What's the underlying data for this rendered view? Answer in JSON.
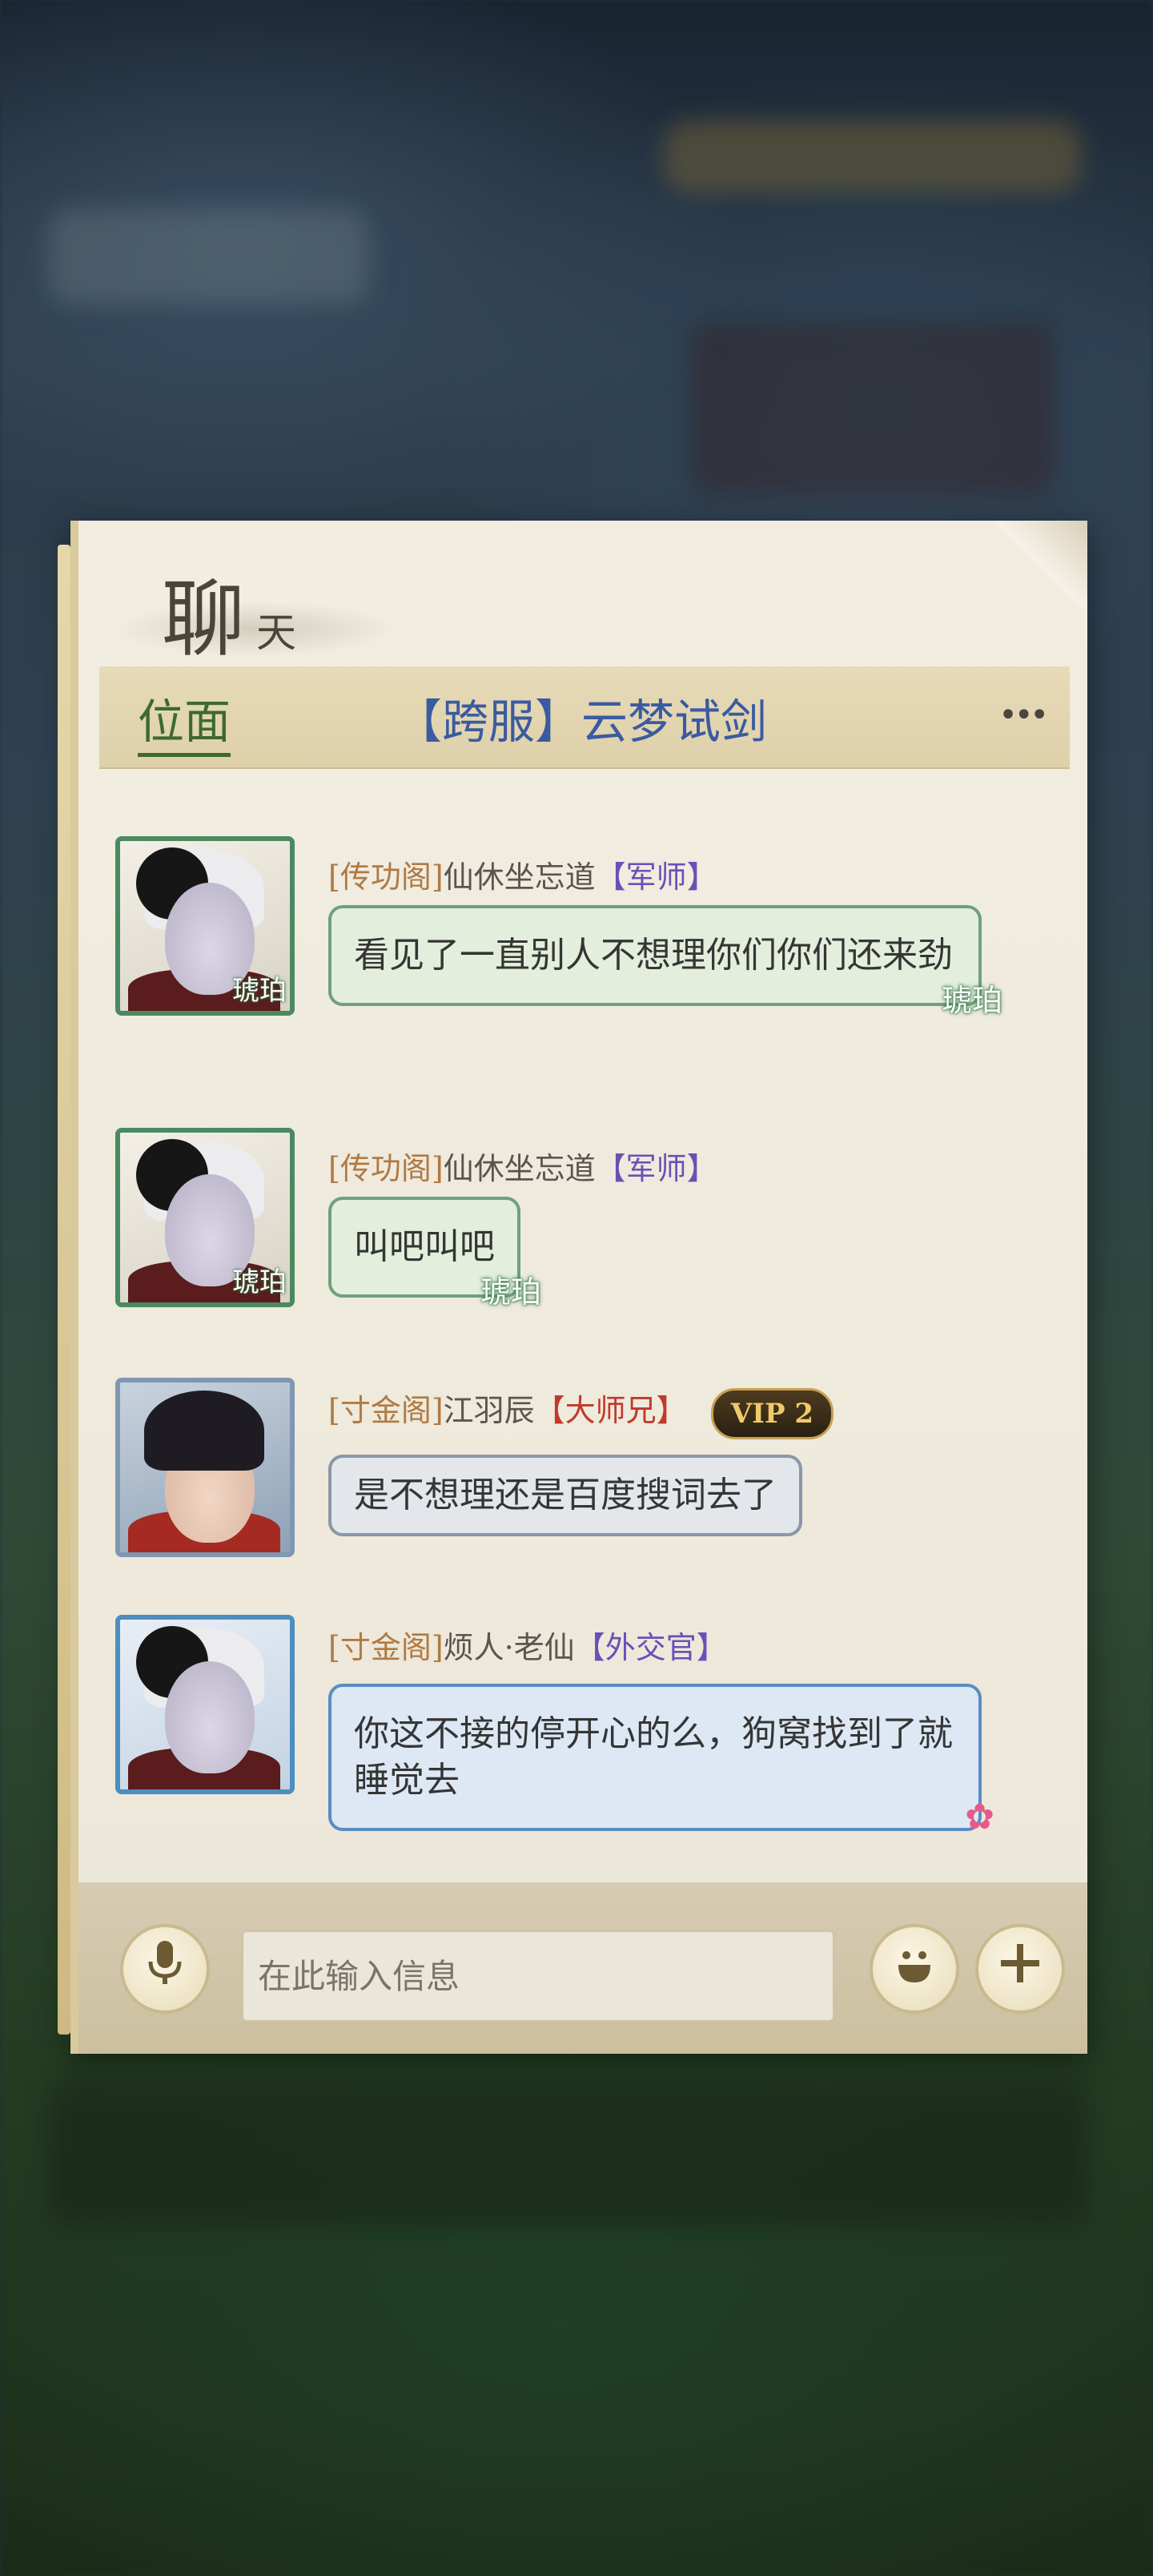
{
  "chat": {
    "title_main": "聊",
    "title_sub": "天",
    "active_tab": "位面",
    "room": "【跨服】云梦试剑",
    "more": "•••"
  },
  "messages": [
    {
      "guild": "[传功阁]",
      "name": "仙休坐忘道",
      "rank": "【军师】",
      "avatar_badge": "琥珀",
      "text": "看见了一直别人不想理你们你们还来劲",
      "bubble_tag": "琥珀"
    },
    {
      "guild": "[传功阁]",
      "name": "仙休坐忘道",
      "rank": "【军师】",
      "avatar_badge": "琥珀",
      "text": "叫吧叫吧",
      "bubble_tag": "琥珀"
    },
    {
      "guild": "[寸金阁]",
      "name": "江羽辰",
      "rank": "【大师兄】",
      "vip": "VIP 2",
      "text": "是不想理还是百度搜词去了"
    },
    {
      "guild": "[寸金阁]",
      "name": "烦人·老仙",
      "rank": "【外交官】",
      "text": "你这不接的停开心的么，狗窝找到了就睡觉去"
    }
  ],
  "input": {
    "placeholder": "在此输入信息"
  },
  "colors": {
    "panel": "#ece7d8",
    "tab_active": "#3d6a2e",
    "room_title": "#3a5ba0",
    "bubble_green_border": "#6fa27a",
    "bubble_blue_border": "#5a8dc1"
  },
  "icons": {
    "voice": "microphone-icon",
    "emoji": "emoji-icon",
    "more_actions": "plus-icon"
  }
}
